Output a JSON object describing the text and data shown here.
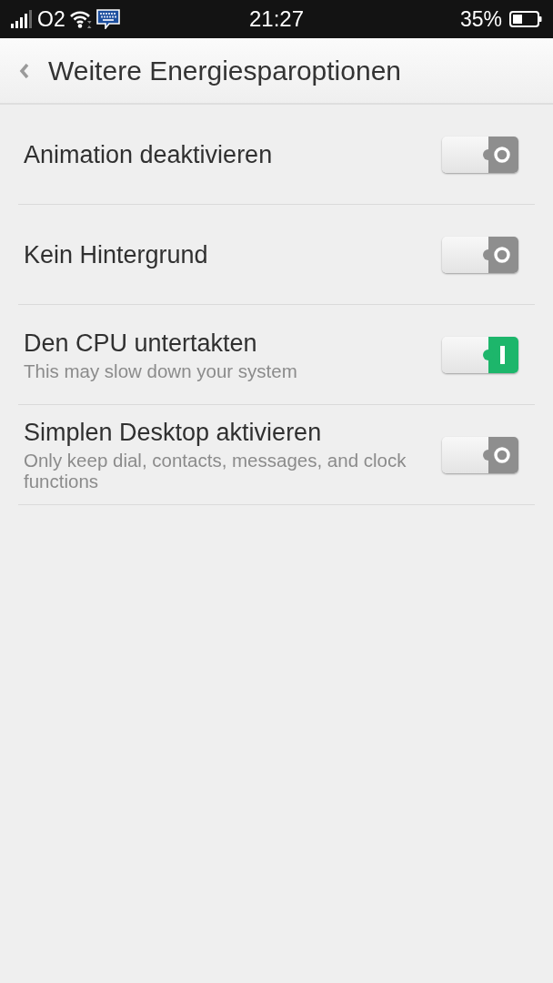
{
  "status_bar": {
    "carrier": "O2",
    "time": "21:27",
    "battery": "35%"
  },
  "header": {
    "title": "Weitere Energiesparoptionen"
  },
  "options": [
    {
      "title": "Animation deaktivieren",
      "on": false
    },
    {
      "title": "Kein Hintergrund",
      "on": false
    },
    {
      "title": "Den CPU untertakten",
      "subtitle": "This may slow down your system",
      "on": true
    },
    {
      "title": "Simplen Desktop aktivieren",
      "subtitle": "Only keep dial, contacts, messages, and clock functions",
      "on": false
    }
  ]
}
